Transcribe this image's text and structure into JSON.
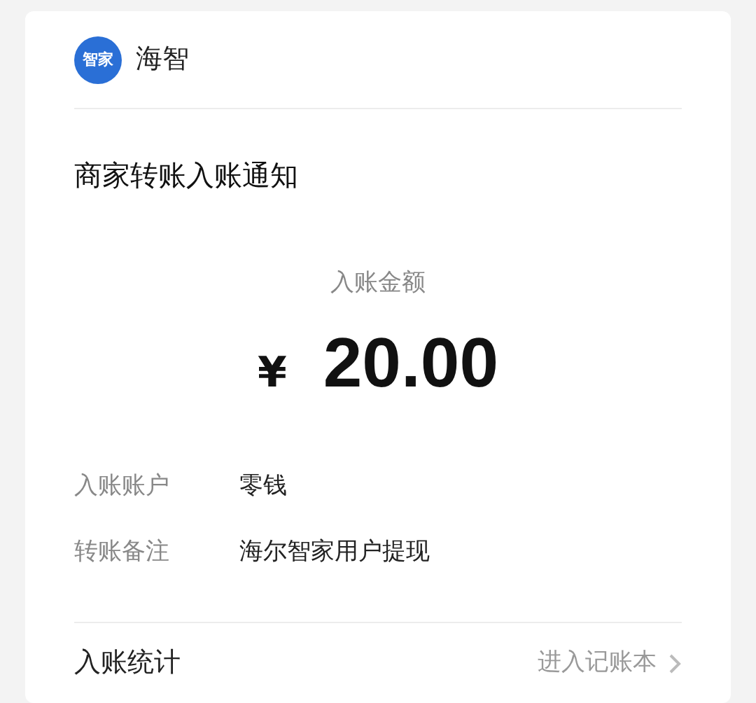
{
  "header": {
    "logo_text": "智家",
    "name": "海智"
  },
  "title": "商家转账入账通知",
  "amount": {
    "label": "入账金额",
    "currency": "¥",
    "value": "20.00"
  },
  "details": [
    {
      "label": "入账账户",
      "value": "零钱"
    },
    {
      "label": "转账备注",
      "value": "海尔智家用户提现"
    }
  ],
  "footer": {
    "label": "入账统计",
    "link": "进入记账本"
  }
}
